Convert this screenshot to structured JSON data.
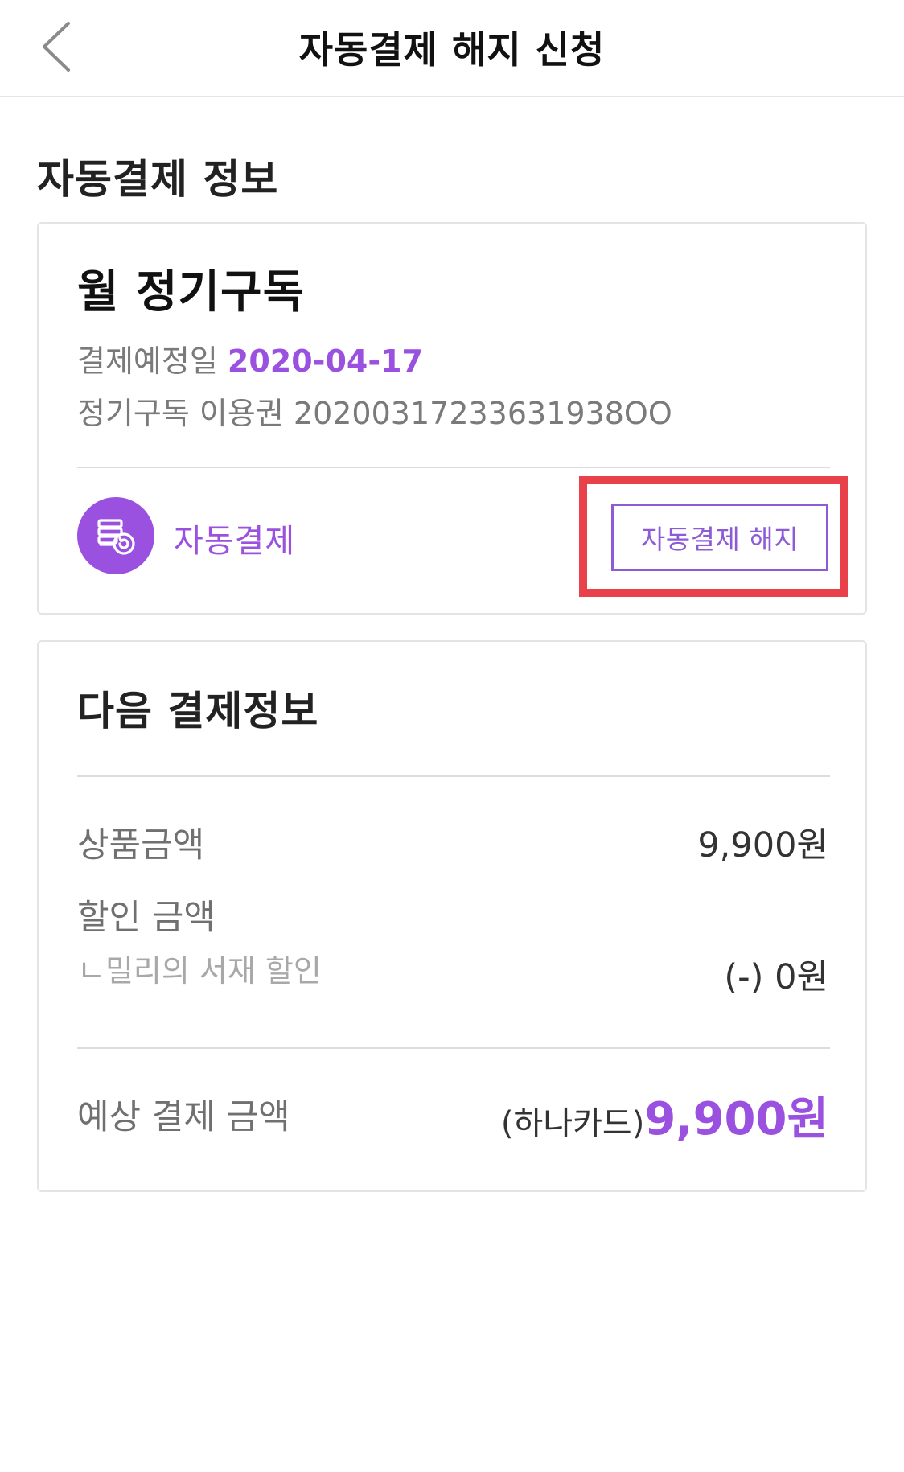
{
  "header": {
    "title": "자동결제 해지 신청",
    "back_icon": "chevron-left-icon"
  },
  "section_title": "자동결제 정보",
  "subscription_card": {
    "plan_name": "월 정기구독",
    "next_payment_label": "결제예정일",
    "next_payment_date": "2020-04-17",
    "pass_label": "정기구독 이용권",
    "pass_id": "20200317233631938OO",
    "auto_icon": "auto-payment-icon",
    "auto_label": "자동결제",
    "cancel_button_label": "자동결제 해지"
  },
  "next_payment_card": {
    "title": "다음 결제정보",
    "rows": {
      "product_amount_label": "상품금액",
      "product_amount_value": "9,900원",
      "discount_label": "할인 금액",
      "discount_sub_label": "ㄴ밀리의 서재 할인",
      "discount_value": "(-) 0원",
      "expected_label": "예상 결제 금액",
      "expected_card": "(하나카드)",
      "expected_amount": "9,900원"
    }
  },
  "colors": {
    "accent": "#9b51e0",
    "button_border": "#8e5bd8",
    "highlight": "#e8414a"
  }
}
